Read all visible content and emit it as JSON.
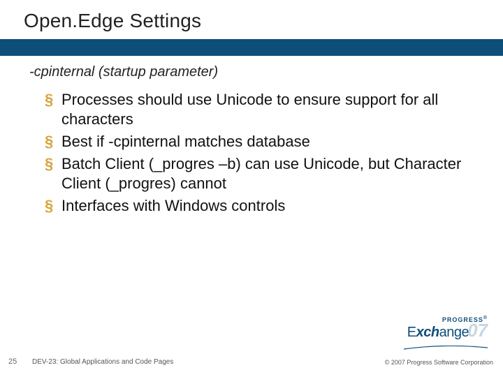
{
  "title": "Open.Edge Settings",
  "subtitle": "-cpinternal (startup parameter)",
  "bullets": [
    {
      "mark": "§",
      "text": "Processes should use Unicode to ensure support for all characters"
    },
    {
      "mark": "§",
      "text": "Best if -cpinternal matches database"
    },
    {
      "mark": "§",
      "text": "Batch Client (_progres –b) can use Unicode, but Character Client (_progres) cannot"
    },
    {
      "mark": "§",
      "text": "Interfaces with Windows controls"
    }
  ],
  "footer": {
    "slide_number": "25",
    "doc_title": "DEV-23: Global Applications and Code Pages",
    "copyright": "© 2007 Progress Software Corporation"
  },
  "logo": {
    "top": "PROGRESS",
    "reg": "®",
    "main_left": "E",
    "main_mid": "xch",
    "main_right": "ange",
    "year": "07"
  }
}
